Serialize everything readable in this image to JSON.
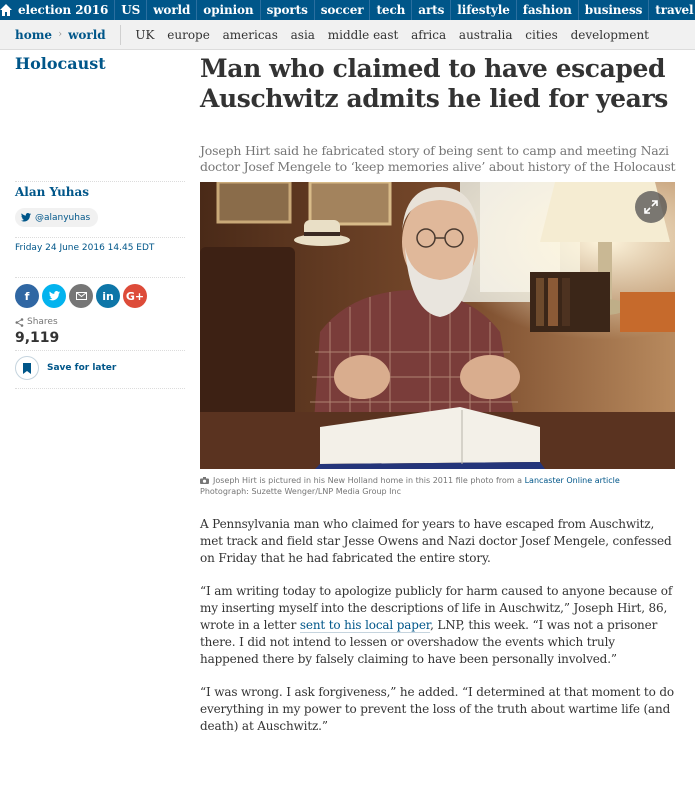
{
  "topnav": {
    "home_icon": "home-icon",
    "items": [
      "election 2016",
      "US",
      "world",
      "opinion",
      "sports",
      "soccer",
      "tech",
      "arts",
      "lifestyle",
      "fashion",
      "business",
      "travel"
    ]
  },
  "subnav": {
    "breadcrumbs": [
      "home",
      "world"
    ],
    "items": [
      "UK",
      "europe",
      "americas",
      "asia",
      "middle east",
      "africa",
      "australia",
      "cities",
      "development"
    ]
  },
  "article": {
    "section": "Holocaust",
    "headline": "Man who claimed to have escaped Auschwitz admits he lied for years",
    "standfirst": "Joseph Hirt said he fabricated story of being sent to camp and meeting Nazi doctor Josef Mengele to ‘keep memories alive’ about history of the Holocaust",
    "author": "Alan Yuhas",
    "twitter_handle": "@alanyuhas",
    "date": "Friday 24 June 2016 14.45 EDT",
    "shares_label": "Shares",
    "shares_count": "9,119",
    "save_label": "Save for later",
    "caption": {
      "text": "Joseph Hirt is pictured in his New Holland home in this 2011 file photo from a ",
      "link": "Lancaster Online article",
      "credit": "Photograph: Suzette Wenger/LNP Media Group Inc"
    },
    "paragraphs": {
      "p1": "A Pennsylvania man who claimed for years to have escaped from Auschwitz, met track and field star Jesse Owens and Nazi doctor Josef Mengele, confessed on Friday that he had fabricated the entire story.",
      "p2_before": "“I am writing today to apologize publicly for harm caused to anyone because of my inserting myself into the descriptions of life in Auschwitz,” Joseph Hirt, 86, wrote in a letter ",
      "p2_link": "sent to his local paper",
      "p2_after": ", LNP, this week. “I was not a prisoner there. I did not intend to lessen or overshadow the events which truly happened there by falsely claiming to have been personally involved.”",
      "p3": "“I was wrong. I ask forgiveness,” he added. “I determined at that moment to do everything in my power to prevent the loss of the truth about wartime life (and death) at Auschwitz.”"
    }
  },
  "share_buttons": [
    {
      "name": "facebook-icon",
      "glyph": "f",
      "color": "#3067a3"
    },
    {
      "name": "twitter-icon",
      "glyph": "t",
      "color": "#03b3ee"
    },
    {
      "name": "email-icon",
      "glyph": "✉",
      "color": "#767676"
    },
    {
      "name": "linkedin-icon",
      "glyph": "in",
      "color": "#0e76a8"
    },
    {
      "name": "google-plus-icon",
      "glyph": "G+",
      "color": "#dd4b39"
    }
  ],
  "colors": {
    "brand": "#005689",
    "text": "#333333",
    "muted": "#767676"
  }
}
